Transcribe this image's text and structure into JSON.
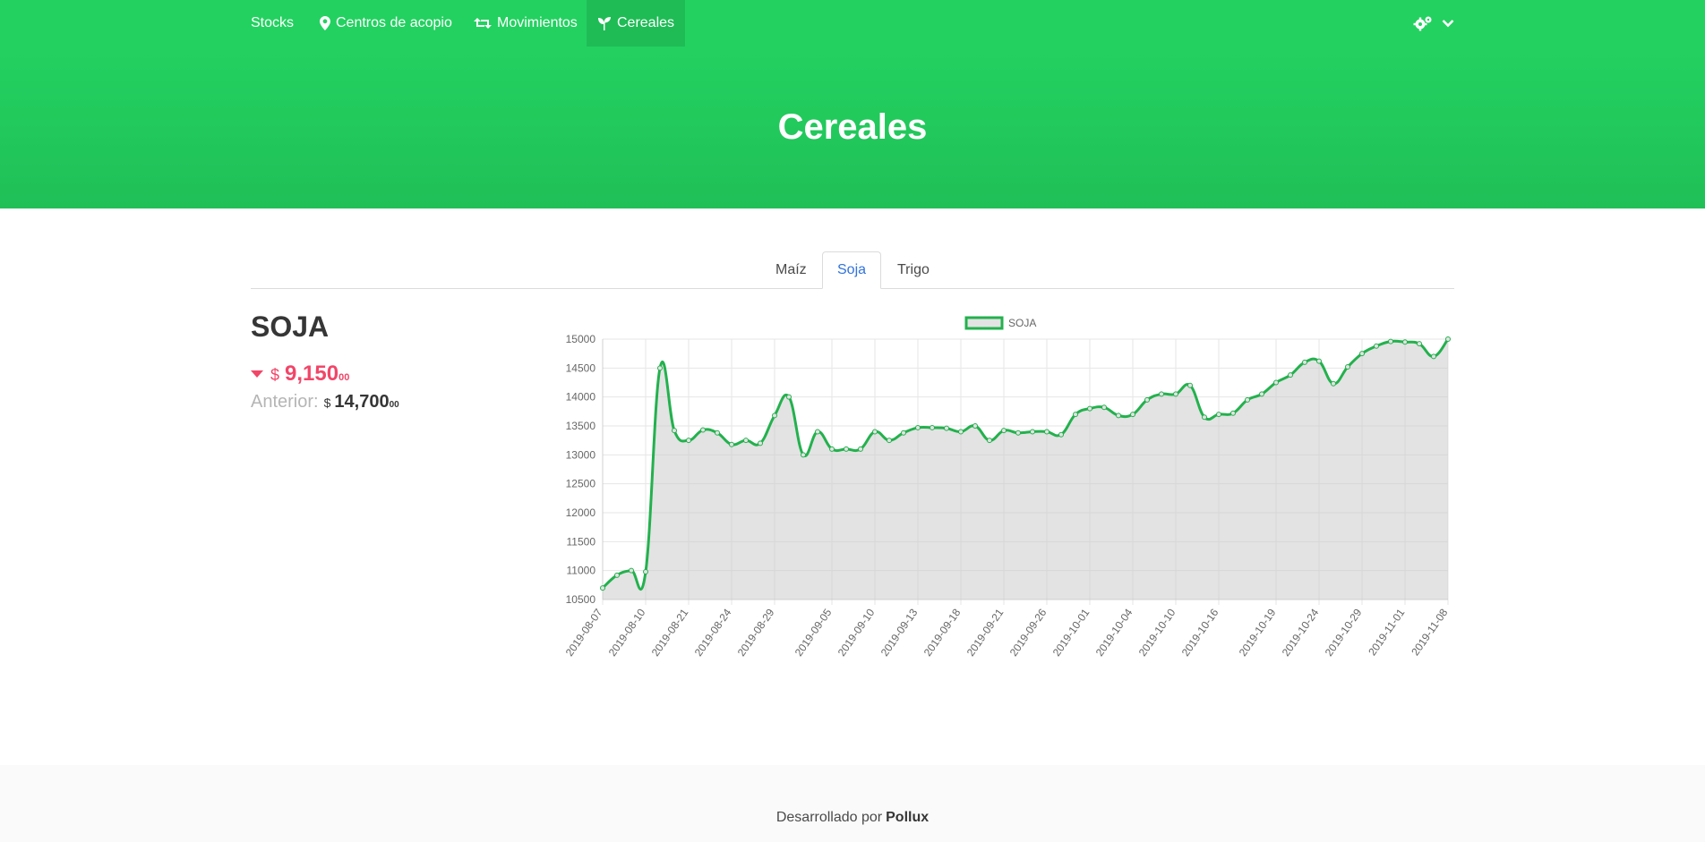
{
  "nav": {
    "items": [
      {
        "label": "Stocks",
        "icon": "none"
      },
      {
        "label": "Centros de acopio",
        "icon": "map-marker-icon"
      },
      {
        "label": "Movimientos",
        "icon": "retweet-icon"
      },
      {
        "label": "Cereales",
        "icon": "seedling-icon"
      }
    ],
    "right_icons": [
      "cogs-icon",
      "chevron-down-icon"
    ]
  },
  "hero": {
    "title": "Cereales"
  },
  "tabs": [
    "Maíz",
    "Soja",
    "Trigo"
  ],
  "active_tab": "Soja",
  "detail": {
    "name": "SOJA",
    "currency": "$",
    "current_int": "9,150",
    "current_dec": "00",
    "previous_label": "Anterior:",
    "previous_int": "14,700",
    "previous_dec": "00"
  },
  "footer": {
    "text": "Desarrollado por",
    "brand": "Pollux"
  },
  "colors": {
    "brand": "#23d160",
    "down": "#f14668",
    "line": "#23b14d",
    "fill": "#e3e3e3"
  },
  "chart_data": {
    "type": "line",
    "legend": "SOJA",
    "ylim": [
      10500,
      15000
    ],
    "yticks": [
      10500,
      11000,
      11500,
      12000,
      12500,
      13000,
      13500,
      14000,
      14500,
      15000
    ],
    "xtick_labels": [
      "2019-08-07",
      "2019-08-10",
      "2019-08-21",
      "2019-08-24",
      "2019-08-29",
      "2019-09-05",
      "2019-09-10",
      "2019-09-13",
      "2019-09-18",
      "2019-09-21",
      "2019-09-26",
      "2019-10-01",
      "2019-10-04",
      "2019-10-10",
      "2019-10-16",
      "2019-10-19",
      "2019-10-24",
      "2019-10-29",
      "2019-11-01",
      "2019-11-08"
    ],
    "values": [
      10700,
      10920,
      11000,
      10980,
      14500,
      13420,
      13250,
      13430,
      13380,
      13180,
      13250,
      13200,
      13680,
      14000,
      13000,
      13400,
      13100,
      13100,
      13100,
      13400,
      13250,
      13380,
      13470,
      13470,
      13460,
      13400,
      13500,
      13250,
      13420,
      13380,
      13400,
      13400,
      13350,
      13700,
      13800,
      13820,
      13680,
      13700,
      13950,
      14050,
      14050,
      14200,
      13650,
      13700,
      13720,
      13950,
      14050,
      14250,
      14380,
      14600,
      14620,
      14230,
      14520,
      14750,
      14880,
      14960,
      14950,
      14920,
      14700,
      15000
    ],
    "grid": true,
    "legend_position": "top"
  }
}
